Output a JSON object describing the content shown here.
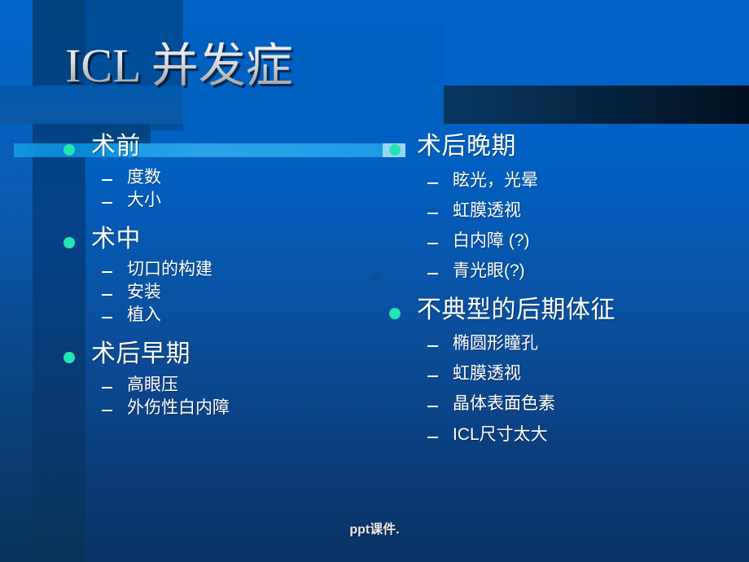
{
  "slide": {
    "title": "ICL 并发症",
    "footer": "ppt课件.",
    "colors": {
      "background_top": "#0063c6",
      "background_bottom": "#0a3263",
      "bullet_dot": "#21e5b2",
      "highlight_bar": "#29a3e8",
      "title_text": "#e2e2e2",
      "body_text": "#ffffff"
    }
  },
  "columns": {
    "left": [
      {
        "label": "术前",
        "children": [
          {
            "label": "度数"
          },
          {
            "label": "大小"
          }
        ]
      },
      {
        "label": "术中",
        "children": [
          {
            "label": "切口的构建"
          },
          {
            "label": "安装"
          },
          {
            "label": "植入"
          }
        ]
      },
      {
        "label": "术后早期",
        "children": [
          {
            "label": "高眼压"
          },
          {
            "label": "外伤性白内障"
          }
        ]
      }
    ],
    "right": [
      {
        "label": "术后晚期",
        "children": [
          {
            "label": "眩光，光晕"
          },
          {
            "label": "虹膜透视"
          },
          {
            "label": "白内障 (?)"
          },
          {
            "label": "青光眼(?)"
          }
        ]
      },
      {
        "label": "不典型的后期体征",
        "children": [
          {
            "label": "椭圆形瞳孔"
          },
          {
            "label": "虹膜透视"
          },
          {
            "label": "晶体表面色素"
          },
          {
            "label": "ICL尺寸太大"
          }
        ]
      }
    ]
  }
}
